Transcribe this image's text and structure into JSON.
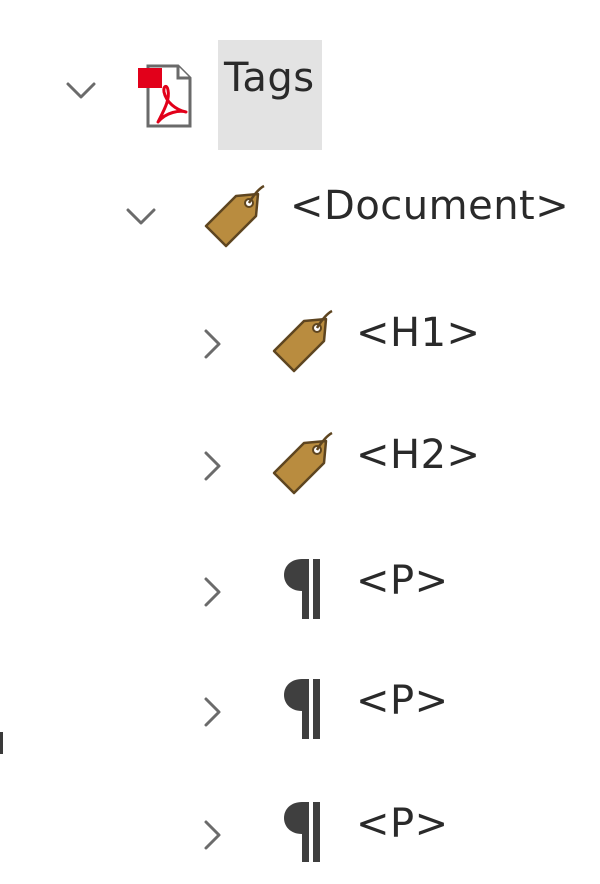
{
  "tags_panel": {
    "root": {
      "label": "Tags",
      "expanded": true,
      "icon": "pdf-document-icon",
      "selected": true
    },
    "document": {
      "label": "<Document>",
      "expanded": true,
      "icon": "tag-icon"
    },
    "children": [
      {
        "label": "<H1>",
        "expanded": false,
        "icon": "tag-icon"
      },
      {
        "label": "<H2>",
        "expanded": false,
        "icon": "tag-icon"
      },
      {
        "label": "<P>",
        "expanded": false,
        "icon": "paragraph-icon"
      },
      {
        "label": "<P>",
        "expanded": false,
        "icon": "paragraph-icon"
      },
      {
        "label": "<P>",
        "expanded": false,
        "icon": "paragraph-icon"
      }
    ]
  },
  "colors": {
    "selection_background": "#e3e3e3",
    "tag_fill": "#b98c3f",
    "pdf_red": "#e2001a",
    "text": "#2a2a2a"
  }
}
